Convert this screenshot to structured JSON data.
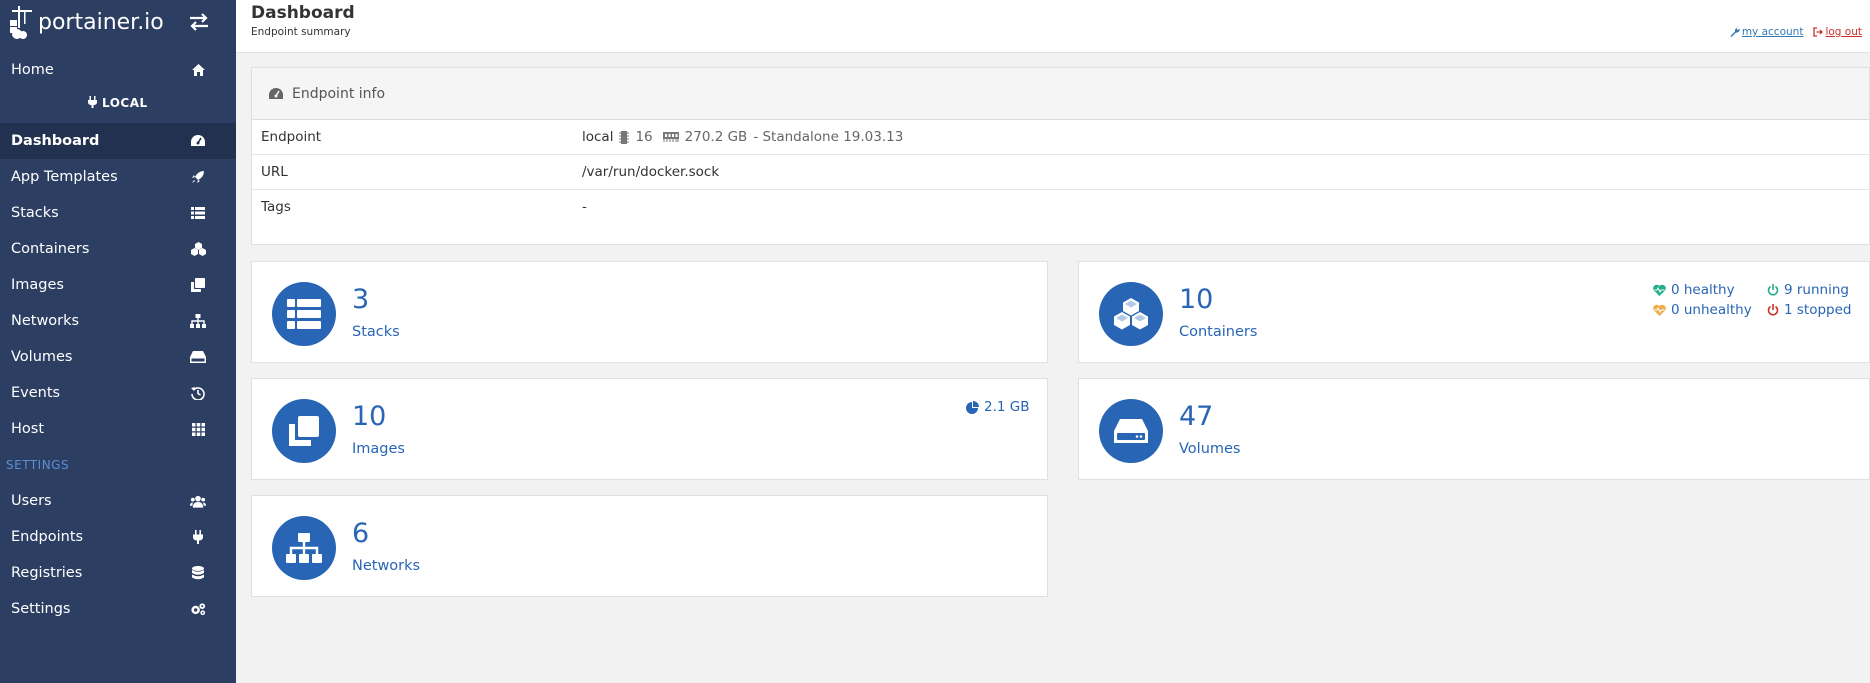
{
  "brand": {
    "name": "portainer.io"
  },
  "sidebar": {
    "home": "Home",
    "endpoint_label": "LOCAL",
    "items": [
      {
        "label": "Dashboard",
        "icon": "dashboard-icon",
        "active": true
      },
      {
        "label": "App Templates",
        "icon": "rocket-icon"
      },
      {
        "label": "Stacks",
        "icon": "list-icon"
      },
      {
        "label": "Containers",
        "icon": "cubes-icon"
      },
      {
        "label": "Images",
        "icon": "clone-icon"
      },
      {
        "label": "Networks",
        "icon": "sitemap-icon"
      },
      {
        "label": "Volumes",
        "icon": "hdd-icon"
      },
      {
        "label": "Events",
        "icon": "history-icon"
      },
      {
        "label": "Host",
        "icon": "grid-icon"
      }
    ],
    "settings_heading": "SETTINGS",
    "settings_items": [
      {
        "label": "Users",
        "icon": "users-icon"
      },
      {
        "label": "Endpoints",
        "icon": "plug-icon"
      },
      {
        "label": "Registries",
        "icon": "database-icon"
      },
      {
        "label": "Settings",
        "icon": "cogs-icon"
      }
    ]
  },
  "header": {
    "title": "Dashboard",
    "subtitle": "Endpoint summary",
    "my_account": "my account",
    "log_out": "log out"
  },
  "endpoint_info": {
    "title": "Endpoint info",
    "rows": {
      "endpoint": {
        "key": "Endpoint",
        "name": "local",
        "cpu": "16",
        "memory": "270.2 GB",
        "mode": "- Standalone 19.03.13"
      },
      "url": {
        "key": "URL",
        "value": "/var/run/docker.sock"
      },
      "tags": {
        "key": "Tags",
        "value": "-"
      }
    }
  },
  "tiles": {
    "stacks": {
      "count": "3",
      "label": "Stacks"
    },
    "containers": {
      "count": "10",
      "label": "Containers",
      "healthy": "0 healthy",
      "unhealthy": "0 unhealthy",
      "running": "9 running",
      "stopped": "1 stopped"
    },
    "images": {
      "count": "10",
      "label": "Images",
      "size": "2.1 GB"
    },
    "volumes": {
      "count": "47",
      "label": "Volumes"
    },
    "networks": {
      "count": "6",
      "label": "Networks"
    }
  },
  "colors": {
    "sidebar_bg": "#2d3e63",
    "sidebar_active": "#223150",
    "accent": "#2865b5",
    "healthy": "#23ae89",
    "unhealthy": "#f0ad4e",
    "running": "#23ae89",
    "stopped": "#c9302c"
  }
}
